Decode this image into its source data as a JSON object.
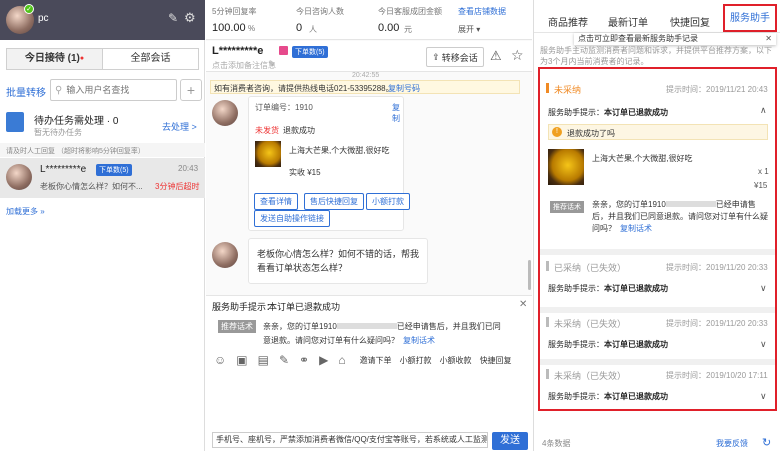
{
  "left": {
    "username": "pc",
    "tab_today": "今日接待 (1)",
    "tab_all": "全部会话",
    "batch_transfer": "批量转移",
    "search_placeholder": "输入用户名查找",
    "task_title": "待办任务需处理 · 0",
    "task_sub": "暂无待办任务",
    "task_action": "去处理 >",
    "manual_notice": "请及时人工回复 （超时将影响5分钟回复率）",
    "conv_name": "L*********e",
    "conv_tag": "下单数(5)",
    "conv_time": "20:43",
    "conv_msg": "老板你心情怎么样？如何不...",
    "conv_timeout": "3分钟后超时",
    "load_more": "加载更多 »"
  },
  "stats": {
    "s1_label": "5分钟回复率",
    "s1_value": "100.00",
    "s1_unit": "%",
    "s2_label": "今日咨询人数",
    "s2_value": "0",
    "s2_unit": "人",
    "s3_label": "今日客服成团金额",
    "s3_value": "0.00",
    "s3_unit": "元",
    "link": "查看店铺数据",
    "expand": "展开 ▾"
  },
  "chat": {
    "user": "L*********e",
    "tag": "下单数(5)",
    "remark": "点击添加备注信息",
    "transfer": "转移会话",
    "time": "20:42:55",
    "banner": "如有消费者咨询，请提供热线电话021-53395288。",
    "banner_copy": "复制号码",
    "order_label": "订单编号：1910",
    "order_copy": "复制",
    "status_unshipped": "未发货",
    "status_refund": "退款成功",
    "product": "上海大芒果,个大微甜,很好吃",
    "paid": "实收 ¥15",
    "btn_detail": "查看详情",
    "btn_aftersale": "售后快捷回复",
    "btn_small": "小额打款",
    "btn_auto": "发送自助操作链接",
    "msg": "老板你心情怎么样？如何不错的话，帮我看看订单状态怎么样？",
    "assist_title": "服务助手提示：",
    "assist_text": "本订单已退款成功",
    "rec_tag": "推荐话术",
    "rec_text": "亲亲，您的订单1910",
    "rec_text2": "已经申请售后，并且我们已同意退款。请问您对订单有什么疑问吗？",
    "rec_copy": "复制话术",
    "tool_invite": "邀请下单",
    "tool_small": "小额打款",
    "tool_collect": "小额收款",
    "tool_quick": "快捷回复",
    "input_text": "手机号、座机号，严禁添加消费者微信/QQ/支付宝等账号，若系统或人工监测",
    "send": "发送"
  },
  "right": {
    "tabs": [
      "商品推荐",
      "最新订单",
      "快捷回复",
      "服务助手"
    ],
    "tooltip": "点击可立即查看最新服务助手记录",
    "desc": "服务助手主动监测消费者问题和诉求，并提供平台推荐方案，以下为3个月内当前消费者的记录。",
    "item1_status": "未采纳",
    "item1_time": "提示时间：2019/11/21 20:43",
    "item_title": "服务助手提示：",
    "item_content": "本订单已退款成功",
    "warn": "退款成功了吗",
    "product": "上海大芒果,个大微甜,很好吃",
    "qty": "x 1",
    "price": "¥15",
    "rec_tag": "推荐话术",
    "rec_text": "亲亲，您的订单1910",
    "rec_text2": "已经申请售后，并且我们已同意退款。请问您对订单有什么疑问吗？",
    "rec_copy": "复制话术",
    "items": [
      {
        "status": "已采纳（已失效）",
        "time": "提示时间：2019/11/20 20:33"
      },
      {
        "status": "未采纳（已失效）",
        "time": "提示时间：2019/11/20 20:33"
      },
      {
        "status": "未采纳（已失效）",
        "time": "提示时间：2019/10/20 17:11"
      }
    ],
    "count": "4条数据",
    "feedback": "我要反馈"
  }
}
